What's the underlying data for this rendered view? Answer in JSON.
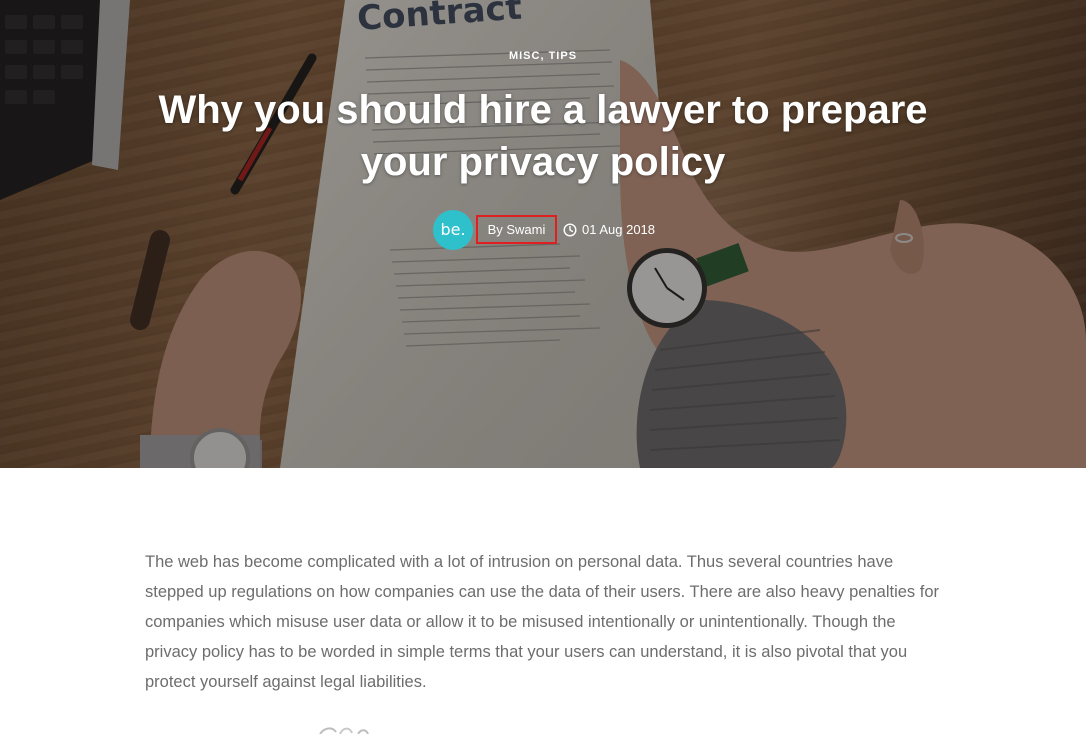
{
  "post": {
    "categories": [
      "MISC",
      "TIPS"
    ],
    "category_separator": ", ",
    "title": "Why you should hire a lawyer to prepare your privacy policy",
    "author_avatar_text": "be.",
    "author": "By Swami",
    "date": "01 Aug 2018",
    "hero_text": "Contract",
    "body": "The web has become complicated with a lot of intrusion on personal data. Thus several countries have stepped up regulations on how companies can use the data of their users. There are also heavy penalties for companies which misuse user data or allow it to be misused intentionally or unintentionally. Though the privacy policy has to be worded in simple terms that your users can understand, it is also pivotal that you protect yourself against legal liabilities."
  },
  "icons": {
    "clock": "clock-icon"
  },
  "colors": {
    "avatar_bg": "#2ec1cc",
    "highlight_border": "#e02020",
    "body_text": "#6d6d6d"
  }
}
